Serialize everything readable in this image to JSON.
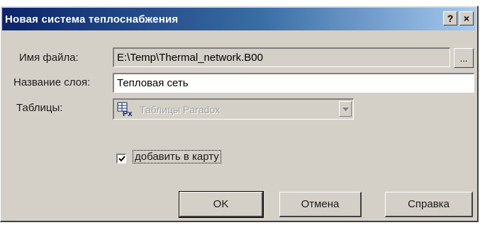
{
  "window": {
    "title": "Новая система теплоснабжения",
    "help_glyph": "?",
    "close_glyph": "×"
  },
  "form": {
    "file_label": "Имя файла:",
    "file_value": "E:\\Temp\\Thermal_network.B00",
    "browse_label": "...",
    "layer_label": "Название слоя:",
    "layer_value": "Тепловая сеть",
    "tables_label": "Таблицы:",
    "tables_value": "Таблицы Paradox",
    "tables_icon": "paradox-px-icon",
    "add_to_map_label": "добавить в карту",
    "add_to_map_checked": true
  },
  "buttons": {
    "ok": "OK",
    "cancel": "Отмена",
    "help": "Справка"
  }
}
